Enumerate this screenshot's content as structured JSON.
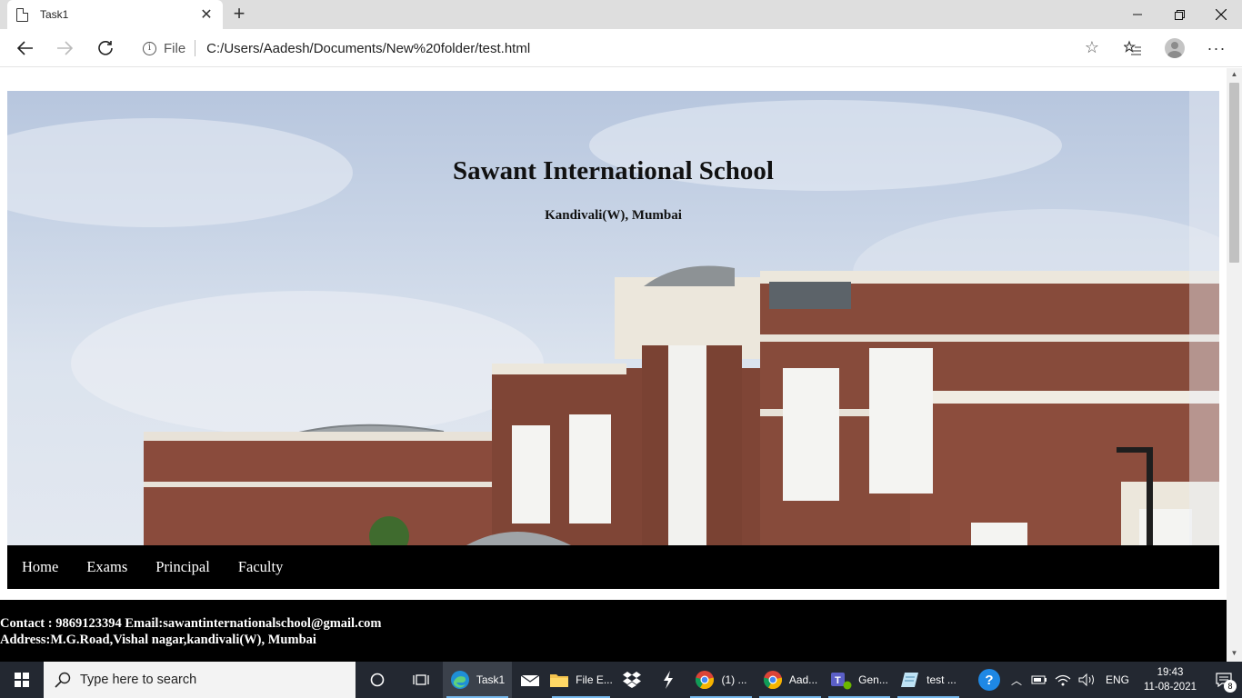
{
  "browser": {
    "tab_title": "Task1",
    "address_label": "File",
    "url": "C:/Users/Aadesh/Documents/New%20folder/test.html"
  },
  "page": {
    "school_name": "Sawant International School",
    "location": "Kandivali(W), Mumbai",
    "nav": [
      "Home",
      "Exams",
      "Principal",
      "Faculty"
    ],
    "contact_line": "Contact : 9869123394 Email:sawantinternationalschool@gmail.com",
    "address_line": "Address:M.G.Road,Vishal nagar,kandivali(W), Mumbai"
  },
  "taskbar": {
    "search_placeholder": "Type here to search",
    "apps": {
      "edge": "Task1",
      "explorer": "File E...",
      "chrome1": "(1) ...",
      "chrome2": "Aad...",
      "teams": "Gen...",
      "notepad": "test ..."
    },
    "language": "ENG",
    "time": "19:43",
    "date": "11-08-2021",
    "notifications": "8"
  },
  "colors": {
    "taskbar_bg": "#232831",
    "nav_bg": "#000000",
    "accent": "#76b9ed"
  }
}
